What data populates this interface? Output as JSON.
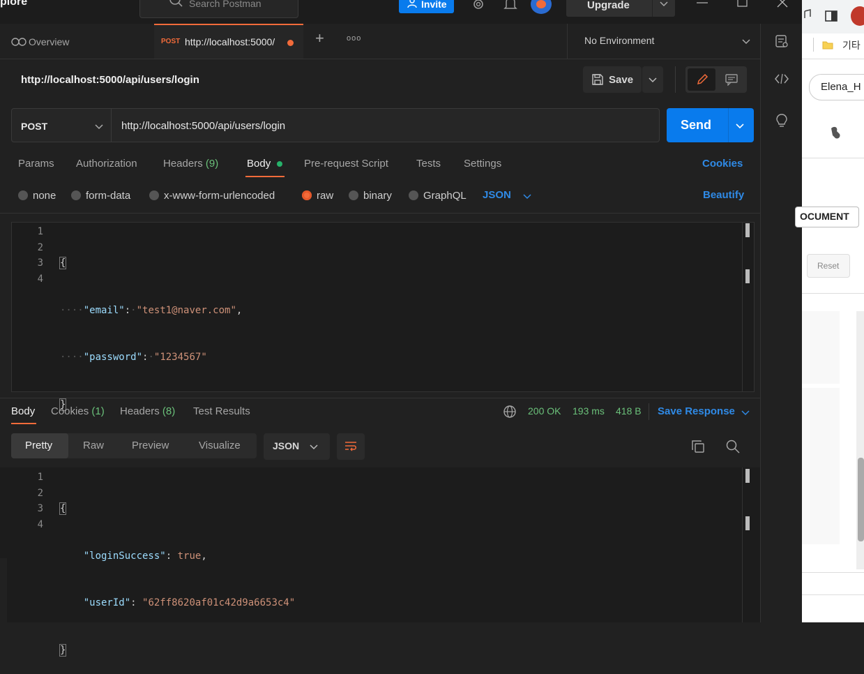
{
  "topbar": {
    "explore": "plore",
    "search_placeholder": "Search Postman",
    "invite": "Invite",
    "upgrade": "Upgrade"
  },
  "tabs": {
    "overview": "Overview",
    "active_method": "POST",
    "active_url": "http://localhost:5000/",
    "add": "+",
    "more": "ooo"
  },
  "environment": "No Environment",
  "request": {
    "title": "http://localhost:5000/api/users/login",
    "save": "Save",
    "method": "POST",
    "url": "http://localhost:5000/api/users/login",
    "send": "Send"
  },
  "req_tabs": {
    "params": "Params",
    "authorization": "Authorization",
    "headers": "Headers",
    "headers_count": "(9)",
    "body": "Body",
    "prerequest": "Pre-request Script",
    "tests": "Tests",
    "settings": "Settings",
    "cookies": "Cookies"
  },
  "body_types": {
    "none": "none",
    "form_data": "form-data",
    "urlencoded": "x-www-form-urlencoded",
    "raw": "raw",
    "binary": "binary",
    "graphql": "GraphQL",
    "json": "JSON",
    "beautify": "Beautify"
  },
  "request_body": {
    "lines": [
      "1",
      "2",
      "3",
      "4"
    ],
    "open": "{",
    "close": "}",
    "email_key": "\"email\"",
    "email_val": "\"test1@naver.com\"",
    "password_key": "\"password\"",
    "password_val": "\"1234567\""
  },
  "response": {
    "tabs": {
      "body": "Body",
      "cookies": "Cookies",
      "cookies_count": "(1)",
      "headers": "Headers",
      "headers_count": "(8)",
      "test_results": "Test Results"
    },
    "status": "200 OK",
    "time": "193 ms",
    "size": "418 B",
    "save_response": "Save Response",
    "views": {
      "pretty": "Pretty",
      "raw": "Raw",
      "preview": "Preview",
      "visualize": "Visualize",
      "format": "JSON"
    },
    "lines": [
      "1",
      "2",
      "3",
      "4"
    ],
    "open": "{",
    "close": "}",
    "login_key": "\"loginSuccess\"",
    "login_val": "true",
    "userid_key": "\"userId\"",
    "userid_val": "\"62ff8620af01c42d9a6653c4\""
  },
  "browser": {
    "label_korean": "기타",
    "profile": "Elena_H",
    "document_btn": "OCUMENT",
    "reset": "Reset"
  },
  "colors": {
    "accent_blue": "#097bed",
    "accent_orange": "#f26b3a",
    "status_green": "#6bc17a"
  }
}
